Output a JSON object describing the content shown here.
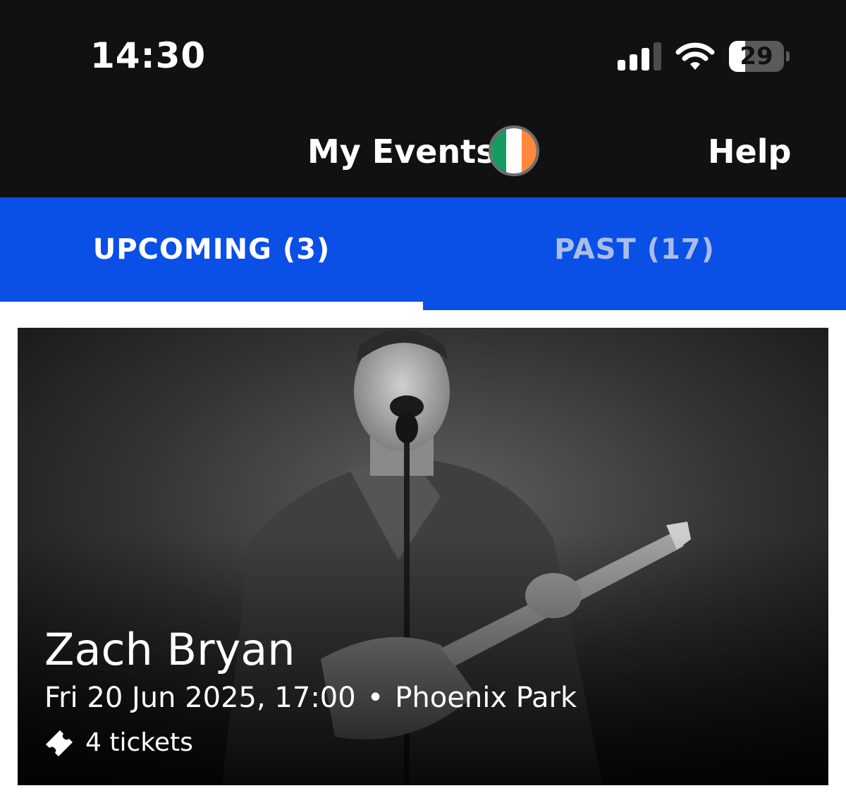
{
  "status_bar": {
    "time": "14:30",
    "battery_level": "29",
    "battery_fraction": 0.29
  },
  "header": {
    "title": "My Events",
    "flag_icon": "ireland-flag-icon",
    "help_label": "Help"
  },
  "tabs": [
    {
      "label": "UPCOMING (3)",
      "active": true
    },
    {
      "label": "PAST (17)",
      "active": false
    }
  ],
  "events": [
    {
      "artist": "Zach Bryan",
      "datetime": "Fri 20 Jun 2025, 17:00",
      "separator": "•",
      "venue": "Phoenix Park",
      "tickets": "4 tickets",
      "ticket_icon": "ticket-icon",
      "image": "black-and-white photo of a singer with an electric guitar at a microphone"
    }
  ],
  "colors": {
    "header_bg": "#111111",
    "tab_bar_bg": "#0a4fe6",
    "active_tab_text": "#ffffff",
    "inactive_tab_text": "#a9bde8",
    "flag_green": "#169b62",
    "flag_white": "#ffffff",
    "flag_orange": "#ff883e"
  }
}
